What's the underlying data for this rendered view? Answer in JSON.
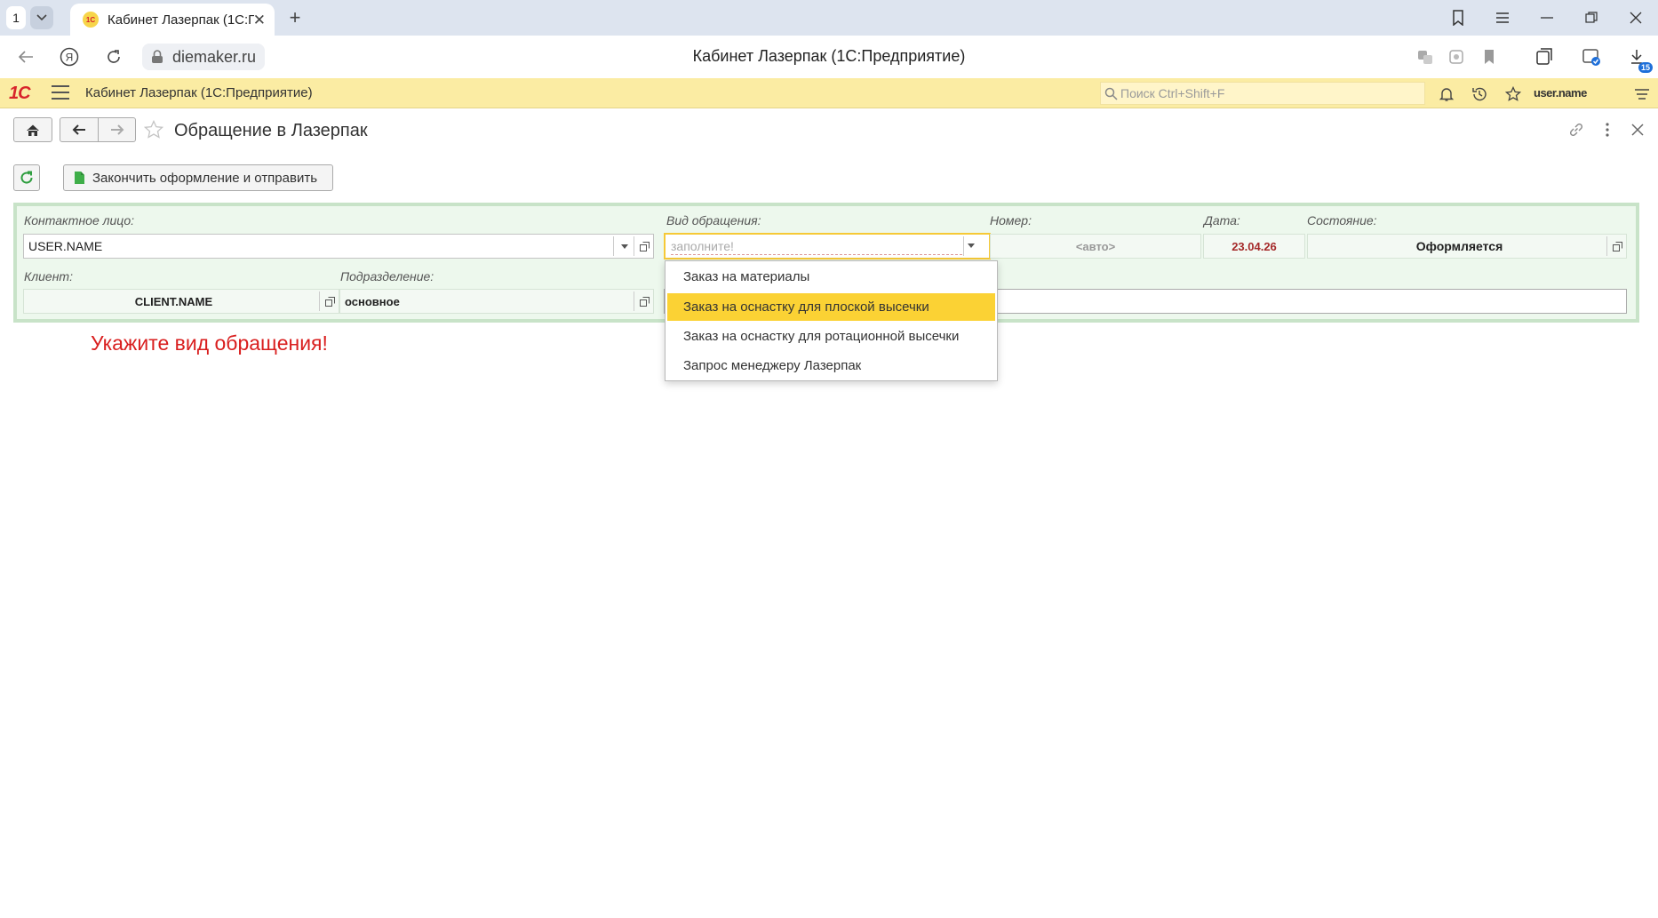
{
  "browser": {
    "tab_count": "1",
    "tab_title": "Кабинет Лазерпак (1С:Предприятие)",
    "favicon_text": "1С",
    "url": "diemaker.ru",
    "page_title": "Кабинет Лазерпак (1С:Предприятие)",
    "downloads_badge": "15"
  },
  "onec": {
    "logo": "1С",
    "app_title": "Кабинет Лазерпак  (1С:Предприятие)",
    "search_placeholder": "Поиск Ctrl+Shift+F",
    "user_name": "user.name"
  },
  "form": {
    "title": "Обращение в Лазерпак",
    "send_button": "Закончить оформление и отправить",
    "fields": {
      "contact_label": "Контактное лицо:",
      "contact_value": "USER.NAME",
      "type_label": "Вид обращения:",
      "type_placeholder": "заполните!",
      "number_label": "Номер:",
      "number_value": "<авто>",
      "date_label": "Дата:",
      "date_value": "23.04.26",
      "state_label": "Состояние:",
      "state_value": "Оформляется",
      "client_label": "Клиент:",
      "client_value": "CLIENT.NAME",
      "division_label": "Подразделение:",
      "division_value": "основное"
    },
    "dropdown_options": [
      "Заказ на материалы",
      "Заказ на оснастку для плоской высечки",
      "Заказ на оснастку для ротационной высечки",
      "Запрос менеджеру Лазерпак"
    ],
    "dropdown_highlighted": "Заказ на оснастку для плоской высечки",
    "warning": "Укажите вид обращения!"
  },
  "colors": {
    "header_bg": "#fbeca3",
    "group_border": "#c8e3c8",
    "group_bg": "#edf8ed",
    "highlight": "#fbd234",
    "warning": "#d91e1e",
    "date": "#a52a2a"
  }
}
